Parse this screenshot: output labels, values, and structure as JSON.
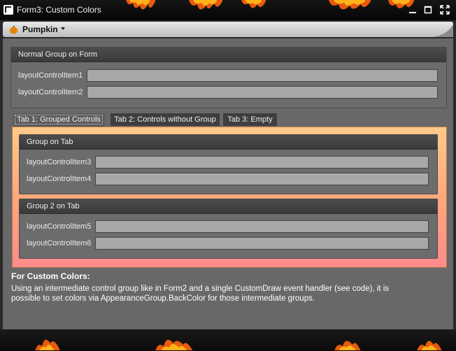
{
  "window": {
    "title": "Form3: Custom Colors",
    "controls": [
      "minimize-icon",
      "maximize-icon",
      "fullscreen-icon"
    ]
  },
  "skin_menu": {
    "label": "Pumpkin",
    "icon": "pumpkin-icon"
  },
  "form_group": {
    "header": "Normal Group on Form",
    "items": [
      {
        "label": "layoutControlItem1",
        "value": ""
      },
      {
        "label": "layoutControlItem2",
        "value": ""
      }
    ]
  },
  "tabs": [
    {
      "label": "Tab 1: Grouped Controls",
      "active": true
    },
    {
      "label": "Tab 2: Controls without Group",
      "active": false
    },
    {
      "label": "Tab 3: Empty",
      "active": false
    }
  ],
  "tab_groups": [
    {
      "header": "Group on Tab",
      "items": [
        {
          "label": "layoutControlItem3",
          "value": ""
        },
        {
          "label": "layoutControlItem4",
          "value": ""
        }
      ]
    },
    {
      "header": "Group 2 on Tab",
      "items": [
        {
          "label": "layoutControlItem5",
          "value": ""
        },
        {
          "label": "layoutControlItem6",
          "value": ""
        }
      ]
    }
  ],
  "note": {
    "title": "For Custom Colors:",
    "line1": "Using an intermediate control group like in Form2 and a single CustomDraw event handler (see code), it is",
    "line2": "possible to set colors via AppearanceGroup.BackColor for those intermediate groups."
  },
  "colors": {
    "tab_gradient_top": "#ffc98a",
    "tab_gradient_bottom": "#ff8b8b",
    "field_bg": "#a8a8a8",
    "client_bg": "#686868"
  }
}
